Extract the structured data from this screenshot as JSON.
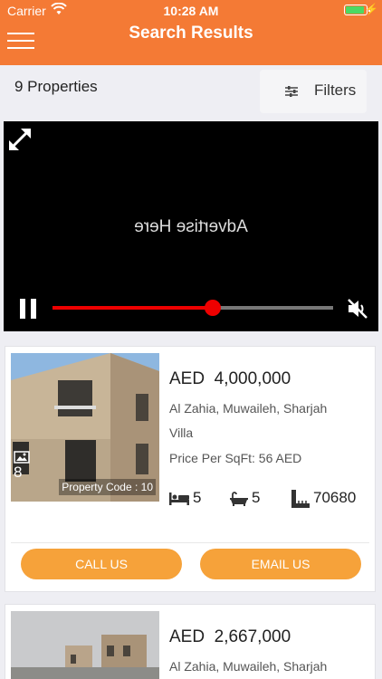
{
  "status_bar": {
    "carrier": "Carrier",
    "time": "10:28 AM"
  },
  "header": {
    "title": "Search Results"
  },
  "toolbar": {
    "count": "9 Properties",
    "filters_label": "Filters"
  },
  "ad": {
    "text": "Advertise Here",
    "progress": 0.57
  },
  "listings": [
    {
      "currency": "AED",
      "price": "4,000,000",
      "location": "Al Zahia,  Muwaileh, Sharjah",
      "type": "Villa",
      "price_per_sqft": "Price Per SqFt: 56  AED",
      "image_count": "8",
      "property_code": "Property Code : 10",
      "bedrooms": "5",
      "bathrooms": "5",
      "area": "70680",
      "call_label": "CALL US",
      "email_label": "EMAIL US"
    },
    {
      "currency": "AED",
      "price": "2,667,000",
      "location": "Al Zahia,  Muwaileh, Sharjah"
    }
  ]
}
